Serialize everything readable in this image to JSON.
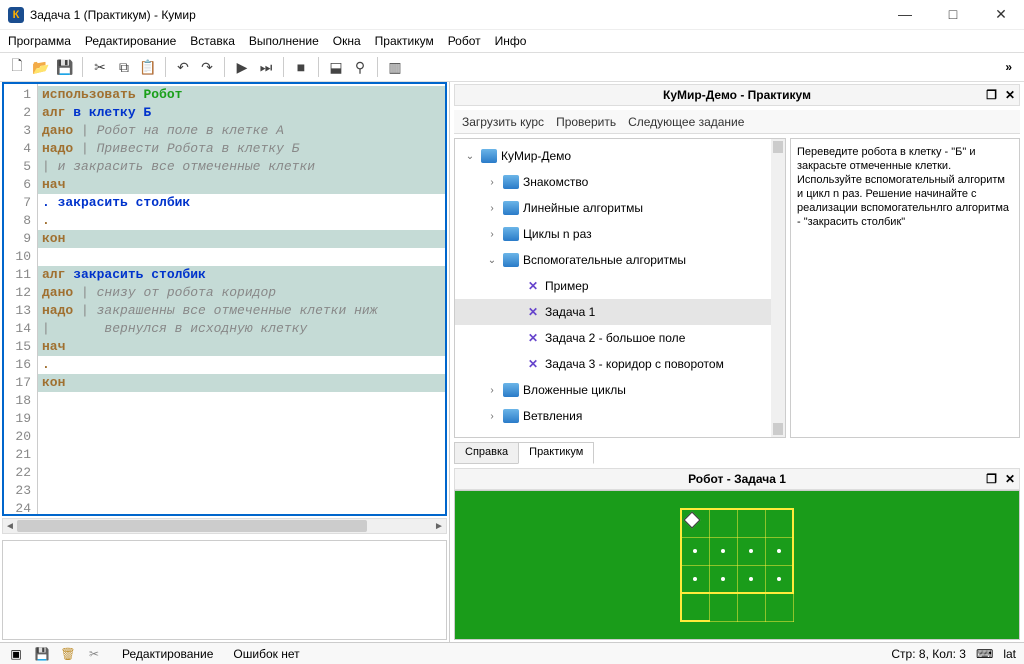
{
  "window": {
    "title": "Задача 1  (Практикум) - Кумир",
    "app_icon_letter": "К"
  },
  "menu": [
    "Программа",
    "Редактирование",
    "Вставка",
    "Выполнение",
    "Окна",
    "Практикум",
    "Робот",
    "Инфо"
  ],
  "code_lines": [
    {
      "n": 1,
      "bg": "teal",
      "html": "<span class='kw'>использовать</span> <span class='rob'>Робот</span>"
    },
    {
      "n": 2,
      "bg": "teal",
      "html": "<span class='kw'>алг</span> <span class='blue'>в клетку Б</span>"
    },
    {
      "n": 3,
      "bg": "teal",
      "html": "<span class='kw'>дано</span> <span class='cmt'>| Робот на поле в клетке А</span>"
    },
    {
      "n": 4,
      "bg": "teal",
      "html": "<span class='kw'>надо</span> <span class='cmt'>| Привести Робота в клетку Б</span>"
    },
    {
      "n": 5,
      "bg": "teal",
      "html": "<span class='cmt'>| и закрасить все отмеченные клетки</span>"
    },
    {
      "n": 6,
      "bg": "teal",
      "html": "<span class='kw'>нач</span>"
    },
    {
      "n": 7,
      "bg": "white",
      "html": "<span class='blue'>. закрасить столбик</span>"
    },
    {
      "n": 8,
      "bg": "white",
      "html": "<span class='kw'>.</span>"
    },
    {
      "n": 9,
      "bg": "teal",
      "html": "<span class='kw'>кон</span>"
    },
    {
      "n": 10,
      "bg": "white",
      "html": ""
    },
    {
      "n": 11,
      "bg": "teal",
      "html": "<span class='kw'>алг</span> <span class='blue'>закрасить столбик</span>"
    },
    {
      "n": 12,
      "bg": "teal",
      "html": "<span class='kw'>дано</span> <span class='cmt'>| снизу от робота коридор</span>"
    },
    {
      "n": 13,
      "bg": "teal",
      "html": "<span class='kw'>надо</span> <span class='cmt'>| закрашенны все отмеченные клетки ниж</span>"
    },
    {
      "n": 14,
      "bg": "teal",
      "html": "<span class='cmt'>|       вернулся в исходную клетку</span>"
    },
    {
      "n": 15,
      "bg": "teal",
      "html": "<span class='kw'>нач</span>"
    },
    {
      "n": 16,
      "bg": "white",
      "html": "<span class='kw'>.</span>"
    },
    {
      "n": 17,
      "bg": "teal",
      "html": "<span class='kw'>кон</span>"
    },
    {
      "n": 18,
      "bg": "white",
      "html": ""
    },
    {
      "n": 19,
      "bg": "white",
      "html": ""
    },
    {
      "n": 20,
      "bg": "white",
      "html": ""
    },
    {
      "n": 21,
      "bg": "white",
      "html": ""
    },
    {
      "n": 22,
      "bg": "white",
      "html": ""
    },
    {
      "n": 23,
      "bg": "white",
      "html": ""
    },
    {
      "n": 24,
      "bg": "white",
      "html": ""
    }
  ],
  "praktikum": {
    "title": "КуМир-Демо - Практикум",
    "tabs": [
      "Загрузить курс",
      "Проверить",
      "Следующее задание"
    ],
    "tree": [
      {
        "indent": 0,
        "tw": "⌄",
        "icon": "folder",
        "label": "КуМир-Демо"
      },
      {
        "indent": 1,
        "tw": "›",
        "icon": "folder",
        "label": "Знакомство"
      },
      {
        "indent": 1,
        "tw": "›",
        "icon": "folder",
        "label": "Линейные алгоритмы"
      },
      {
        "indent": 1,
        "tw": "›",
        "icon": "folder",
        "label": "Циклы n раз"
      },
      {
        "indent": 1,
        "tw": "⌄",
        "icon": "folder",
        "label": "Вспомогательные алгоритмы"
      },
      {
        "indent": 2,
        "tw": "",
        "icon": "task",
        "label": "Пример"
      },
      {
        "indent": 2,
        "tw": "",
        "icon": "task",
        "label": "Задача 1",
        "selected": true
      },
      {
        "indent": 2,
        "tw": "",
        "icon": "task",
        "label": "Задача 2 - большое поле"
      },
      {
        "indent": 2,
        "tw": "",
        "icon": "task",
        "label": "Задача 3 - коридор с поворотом"
      },
      {
        "indent": 1,
        "tw": "›",
        "icon": "folder",
        "label": "Вложенные циклы"
      },
      {
        "indent": 1,
        "tw": "›",
        "icon": "folder",
        "label": "Ветвления"
      }
    ],
    "description": "Переведите робота в клетку - \"Б\" и закрасьте отмеченные клетки. Используйте вспомогательный алгоритм и цикл n раз. Решение начинайте с реализации вспомогательнлго алгоритма - \"закрасить столбик\"",
    "bottom_tabs": {
      "help": "Справка",
      "praktikum": "Практикум"
    }
  },
  "robot": {
    "title": "Робот - Задача 1"
  },
  "status": {
    "mode": "Редактирование",
    "errors": "Ошибок нет",
    "pos": "Стр: 8, Кол: 3",
    "lang": "lat"
  }
}
